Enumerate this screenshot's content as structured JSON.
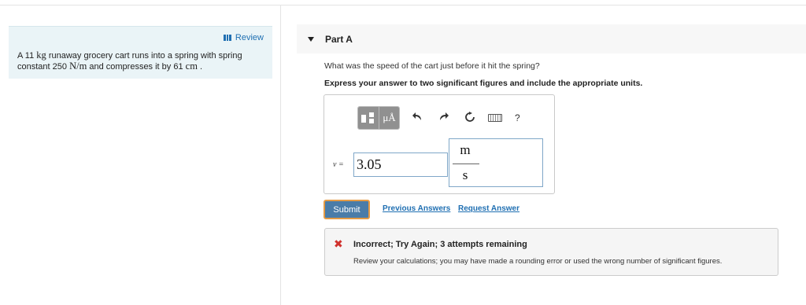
{
  "problem": {
    "review_label": "Review",
    "text_parts": {
      "p1": "A 11 ",
      "m1": "kg",
      "p2": " runaway grocery cart runs into a spring with spring constant 250 ",
      "m2": "N/m",
      "p3": " and compresses it by 61 ",
      "m3": "cm",
      "p4": " ."
    }
  },
  "part": {
    "title": "Part A",
    "question": "What was the speed of the cart just before it hit the spring?",
    "instruction": "Express your answer to two significant figures and include the appropriate units."
  },
  "toolbar": {
    "units_button_label": "μÅ",
    "help_label": "?"
  },
  "answer": {
    "variable_label": "v =",
    "value": "3.05",
    "unit_numerator": "m",
    "unit_denominator": "s"
  },
  "actions": {
    "submit_label": "Submit",
    "previous_answers_label": "Previous Answers",
    "request_answer_label": "Request Answer"
  },
  "feedback": {
    "icon": "✖",
    "title": "Incorrect; Try Again; 3 attempts remaining",
    "message": "Review your calculations; you may have made a rounding error or used the wrong number of significant figures."
  },
  "colors": {
    "link": "#1f6fb2",
    "submit_bg": "#4a7ca8",
    "submit_focus": "#e59b45",
    "error": "#d0312d",
    "problem_bg": "#eaf4f7"
  },
  "icons": {
    "review": "review-icon",
    "templates": "templates-icon",
    "undo": "undo-icon",
    "redo": "redo-icon",
    "reset": "reset-icon",
    "keyboard": "keyboard-icon",
    "help": "help-icon",
    "collapse": "caret-down-icon",
    "error": "error-x-icon"
  }
}
